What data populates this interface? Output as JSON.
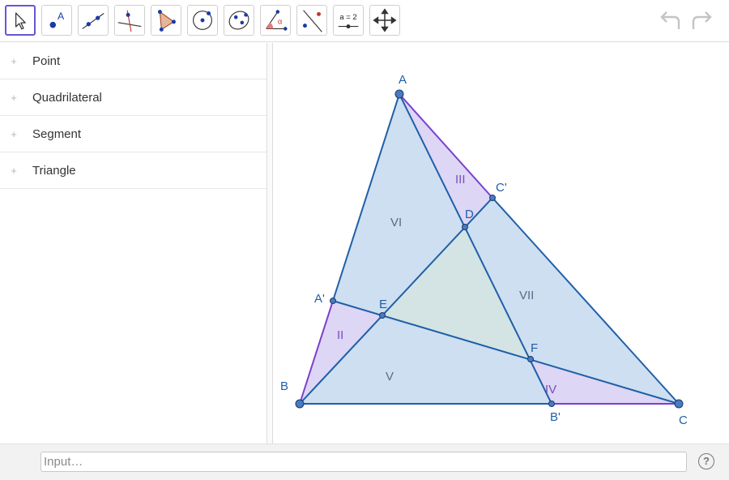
{
  "toolbar": {
    "tools": [
      {
        "name": "move-tool"
      },
      {
        "name": "point-tool",
        "glyph": "A"
      },
      {
        "name": "line-tool"
      },
      {
        "name": "perpendicular-line-tool"
      },
      {
        "name": "polygon-tool"
      },
      {
        "name": "circle-center-point-tool"
      },
      {
        "name": "conic-five-points-tool"
      },
      {
        "name": "angle-tool",
        "glyph": "α"
      },
      {
        "name": "reflect-about-line-tool"
      },
      {
        "name": "slider-tool",
        "glyph": "a = 2"
      },
      {
        "name": "move-graphics-view-tool"
      }
    ],
    "undo_icon": "undo-icon",
    "redo_icon": "redo-icon"
  },
  "algebra": {
    "items": [
      {
        "label": "Point"
      },
      {
        "label": "Quadrilateral"
      },
      {
        "label": "Segment"
      },
      {
        "label": "Triangle"
      }
    ],
    "expand_glyph": "+"
  },
  "graphics": {
    "points": [
      {
        "label": "A"
      },
      {
        "label": "B"
      },
      {
        "label": "C"
      },
      {
        "label": "A'"
      },
      {
        "label": "B'"
      },
      {
        "label": "C'"
      },
      {
        "label": "D"
      },
      {
        "label": "E"
      },
      {
        "label": "F"
      }
    ],
    "regions": [
      {
        "label": "II"
      },
      {
        "label": "III"
      },
      {
        "label": "IV"
      },
      {
        "label": "V"
      },
      {
        "label": "VI"
      },
      {
        "label": "VII"
      }
    ],
    "colors": {
      "segment": "#1565c0",
      "outer_segment": "#7b3fd1",
      "fill_main": "#c8dcf0",
      "fill_center": "#d4e4e4",
      "fill_corner": "#ddd6f5",
      "region_label": "#5a6a8a",
      "corner_label": "#7a4dbf",
      "point_label": "#1f5fa8"
    }
  },
  "input": {
    "placeholder": "Input…",
    "value": "",
    "help_glyph": "?"
  }
}
